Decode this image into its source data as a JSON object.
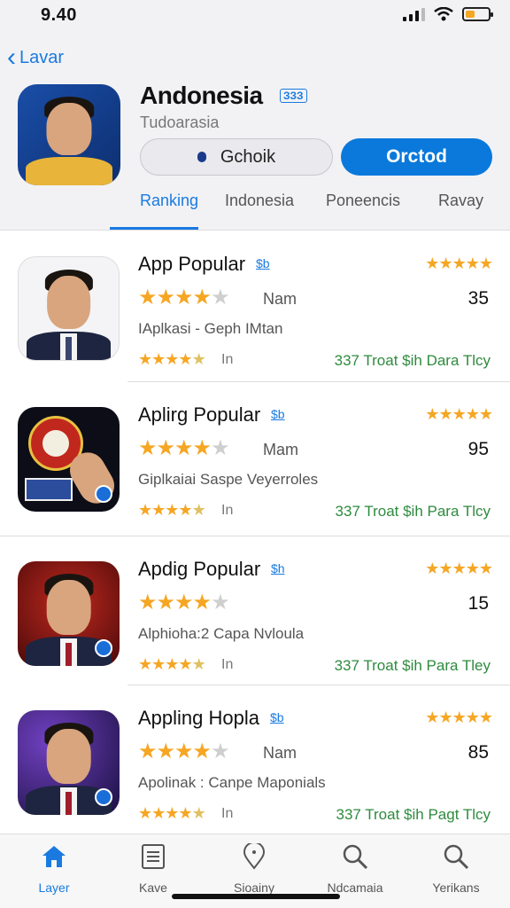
{
  "status": {
    "time": "9.40",
    "battery_level": 0.4
  },
  "nav": {
    "back_label": "Lavar"
  },
  "app": {
    "title": "Andonesia",
    "badge": "ЗЗЗ",
    "subtitle": "Tudoarasia",
    "secondary_button": "Gchoik",
    "primary_button": "Orctod"
  },
  "tabs": [
    "Ranking",
    "Indonesia",
    "Poneencis",
    "Ravay"
  ],
  "active_tab": 0,
  "rows": [
    {
      "title": "App  Popular",
      "badge": "$b",
      "meta": "Nam",
      "count": "35",
      "desc": "IAplkasi  -  Geph IMtan",
      "small_meta": "In",
      "green": "337 Troat $ih Dara Tlcy",
      "rating_top": 4.5,
      "rating_big": 4,
      "rating_small": 4.5
    },
    {
      "title": "Aplirg Popular",
      "badge": "$b",
      "meta": "Mam",
      "count": "95",
      "desc": "Giplkaiai Saspe Veyerroles",
      "small_meta": "In",
      "green": "337 Troat $ih Para Tlcy",
      "rating_top": 4.5,
      "rating_big": 4,
      "rating_small": 4.5
    },
    {
      "title": "Apdig Popular",
      "badge": "$h",
      "meta": "",
      "count": "15",
      "desc": "Alphioha:2 Capa Nvloula",
      "small_meta": "In",
      "green": "337 Troat $ih Para Tley",
      "rating_top": 4.5,
      "rating_big": 4,
      "rating_small": 4.5
    },
    {
      "title": "Appling Hopla",
      "badge": "$b",
      "meta": "Nam",
      "count": "85",
      "desc": "Apolinak : Canpe Maponials",
      "small_meta": "In",
      "green": "337 Troat $ih Pagt Tlcy",
      "rating_top": 4.5,
      "rating_big": 4,
      "rating_small": 4.5
    }
  ],
  "tabbar": [
    {
      "label": "Layer",
      "icon": "home-icon"
    },
    {
      "label": "Kave",
      "icon": "list-icon"
    },
    {
      "label": "Sioainy",
      "icon": "location-icon"
    },
    {
      "label": "Ndcamaia",
      "icon": "search-icon"
    },
    {
      "label": "Yerikans",
      "icon": "search-icon"
    }
  ],
  "colors": {
    "accent": "#0a79db",
    "star": "#f5a623",
    "green_text": "#2e8b3e"
  }
}
